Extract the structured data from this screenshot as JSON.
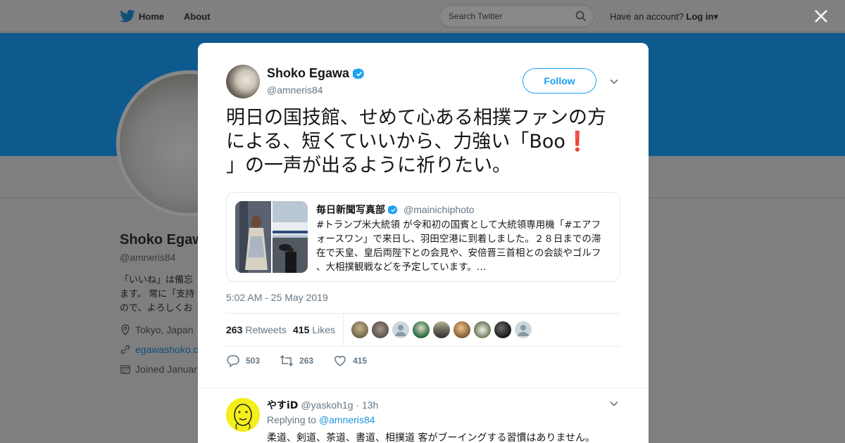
{
  "nav": {
    "home": "Home",
    "about": "About",
    "search_placeholder": "Search Twitter",
    "account_prompt": "Have an account?",
    "login": "Log in"
  },
  "profile": {
    "name": "Shoko Egawa",
    "handle": "@amneris84",
    "bio_line1": "「いいね」は備忘",
    "bio_line2": "ます。 常に「支持",
    "bio_line3": "ので、よろしくお",
    "location": "Tokyo, Japan",
    "website": "egawashoko.c",
    "joined": "Joined Januar"
  },
  "tweet": {
    "author_name": "Shoko Egawa",
    "author_handle": "@amneris84",
    "follow_label": "Follow",
    "text_line1": "明日の国技館、せめて心ある相撲ファンの方",
    "text_line2": "による、短くていいから、力強い「Boo",
    "text_exclaim": "❗",
    "text_line3": "」の一声が出るように祈りたい。",
    "timestamp": "5:02 AM - 25 May 2019",
    "retweets_count": "263",
    "retweets_label": "Retweets",
    "likes_count": "415",
    "likes_label": "Likes",
    "reply_action_count": "503",
    "retweet_action_count": "263",
    "like_action_count": "415"
  },
  "quote": {
    "name": "毎日新聞写真部",
    "handle": "@mainichiphoto",
    "line1": "#トランプ米大統領 が令和初の国賓として大統領専用機「#エアフ",
    "line2": "ォースワン」で来日し、羽田空港に到着しました。２８日までの滞",
    "line3": "在で天皇、皇后両陛下との会見や、安倍晋三首相との会談やゴルフ",
    "line4": "、大相撲観戦などを予定しています。…"
  },
  "reply": {
    "name": "やすiD",
    "handle": "@yaskoh1g",
    "time": "· 13h",
    "replying_prefix": "Replying to",
    "replying_to": "@amneris84",
    "text": "柔道、剣道、茶道、書道、相撲道 客がブーイングする習慣はありません。"
  },
  "colors": {
    "accent": "#1da1f2",
    "banner": "#0e5a8f",
    "overlay_bg": "#7f7f7f",
    "text_secondary": "#657786"
  }
}
